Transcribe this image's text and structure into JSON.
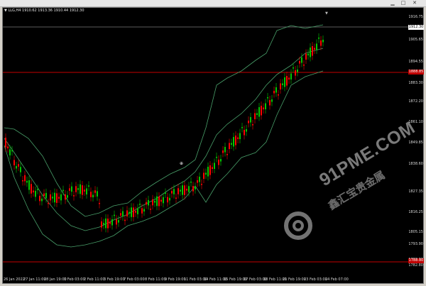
{
  "window": {
    "title": "LLG,H4",
    "ohlc": "1910.62 1913.36 1910.44 1912.30"
  },
  "colors": {
    "bull": "#00c800",
    "bear": "#ff0000",
    "band": "#49a06a",
    "line": "#c40000",
    "price_tag": "#c00000",
    "bg": "#000000"
  },
  "price_axis": [
    "1916.75",
    "1912.30",
    "1905.65",
    "1894.55",
    "1888.85",
    "1883.30",
    "1872.20",
    "1861.10",
    "1849.85",
    "1838.60",
    "1827.35",
    "1816.25",
    "1805.15",
    "1793.90",
    "1788.80",
    "1782.80"
  ],
  "time_axis": [
    "26 Jan 2022",
    "27 Jan 11:00",
    "28 Jan 19:00",
    "1 Feb 03:00",
    "2 Feb 11:00",
    "3 Feb 19:00",
    "7 Feb 03:00",
    "8 Feb 11:00",
    "9 Feb 19:00",
    "11 Feb 03:00",
    "14 Feb 11:00",
    "15 Feb 19:00",
    "17 Feb 03:00",
    "18 Feb 11:00",
    "21 Feb 19:00",
    "23 Feb 03:00",
    "24 Feb 07:00"
  ],
  "watermark": {
    "brand": "91PME.COM",
    "chinese": "鑫汇宝贵金属"
  },
  "icons": [
    "close-icon",
    "chart-marker-icon"
  ]
}
